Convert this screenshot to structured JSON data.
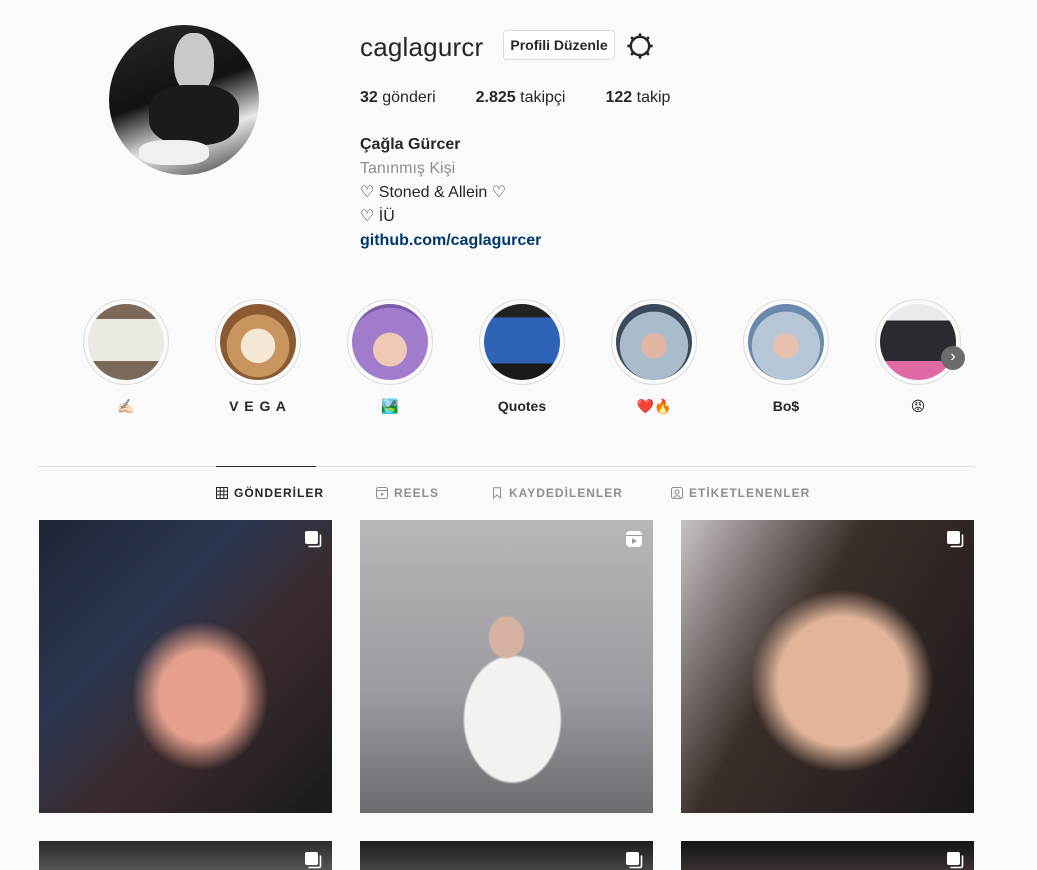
{
  "profile": {
    "username": "caglagurcr",
    "edit_label": "Profili Düzenle",
    "stats": {
      "posts_count": "32",
      "posts_label": "gönderi",
      "followers_count": "2.825",
      "followers_label": "takipçi",
      "following_count": "122",
      "following_label": "takip"
    },
    "bio": {
      "full_name": "Çağla Gürcer",
      "category": "Tanınmış Kişi",
      "line1": "♡ Stoned & Allein ♡",
      "line2": "♡ İÜ",
      "link": "github.com/caglagurcer"
    }
  },
  "highlights": [
    {
      "label": "✍🏻",
      "thumb": "card-text",
      "color": "#8a7a6e"
    },
    {
      "label": "V E G A",
      "thumb": "cat",
      "color": "#c89a6a"
    },
    {
      "label": "🏞️",
      "thumb": "purple-hair",
      "color": "#9f7bc4"
    },
    {
      "label": "Quotes",
      "thumb": "tv-screen",
      "color": "#2b5fb0"
    },
    {
      "label": "❤️🔥",
      "thumb": "selfie",
      "color": "#6f8aa0"
    },
    {
      "label": "Bo$",
      "thumb": "selfie-blue",
      "color": "#7da0c8"
    },
    {
      "label": "😡",
      "thumb": "outfit",
      "color": "#d86ba0"
    }
  ],
  "tabs": [
    {
      "label": "GÖNDERİLER",
      "icon": "grid-icon",
      "active": true
    },
    {
      "label": "REELS",
      "icon": "reels-icon",
      "active": false
    },
    {
      "label": "KAYDEDİLENLER",
      "icon": "bookmark-icon",
      "active": false
    },
    {
      "label": "ETİKETLENENLER",
      "icon": "tag-user-icon",
      "active": false
    }
  ],
  "posts": [
    {
      "type": "carousel"
    },
    {
      "type": "reel"
    },
    {
      "type": "carousel"
    },
    {
      "type": "carousel"
    },
    {
      "type": "carousel"
    },
    {
      "type": "carousel"
    }
  ],
  "colors": {
    "link": "#00376b",
    "muted": "#8e8e8e",
    "border": "#dbdbdb",
    "text": "#262626"
  }
}
